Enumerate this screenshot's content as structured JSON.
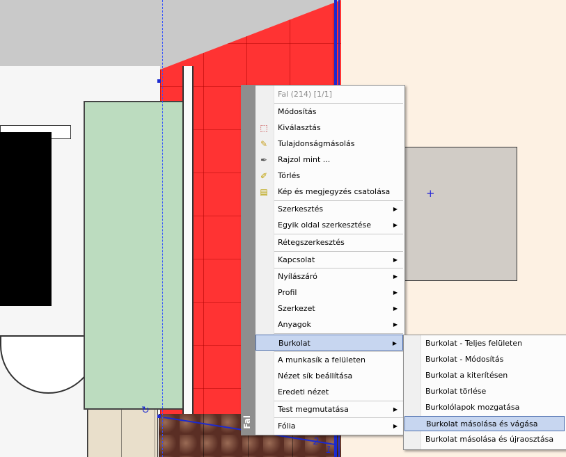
{
  "menu": {
    "side_label": "Fal",
    "header": "Fal (214) [1/1]",
    "items": [
      {
        "label": "Módosítás"
      },
      {
        "label": "Kiválasztás",
        "icon": "selection-icon"
      },
      {
        "label": "Tulajdonságmásolás",
        "icon": "brush-icon"
      },
      {
        "label": "Rajzol mint ...",
        "icon": "pipette-icon"
      },
      {
        "label": "Törlés",
        "icon": "eraser-icon"
      },
      {
        "label": "Kép és megjegyzés csatolása",
        "icon": "note-icon"
      },
      {
        "label": "Szerkesztés"
      },
      {
        "label": "Egyik oldal szerkesztése"
      },
      {
        "label": "Rétegszerkesztés"
      },
      {
        "label": "Kapcsolat"
      },
      {
        "label": "Nyílászáró"
      },
      {
        "label": "Profil"
      },
      {
        "label": "Szerkezet"
      },
      {
        "label": "Anyagok"
      },
      {
        "label": "Burkolat"
      },
      {
        "label": "A munkasík a felületen"
      },
      {
        "label": "Nézet sík beállítása"
      },
      {
        "label": "Eredeti nézet"
      },
      {
        "label": "Test megmutatása"
      },
      {
        "label": "Fólia"
      }
    ]
  },
  "submenu": {
    "items": [
      {
        "label": "Burkolat - Teljes felületen"
      },
      {
        "label": "Burkolat - Módosítás"
      },
      {
        "label": "Burkolat a kiterítésen"
      },
      {
        "label": "Burkolat törlése"
      },
      {
        "label": "Burkolólapok mozgatása"
      },
      {
        "label": "Burkolat másolása és vágása"
      },
      {
        "label": "Burkolat másolása és újraosztása"
      }
    ]
  },
  "viewport": {
    "dim_label_1": "2",
    "dim_label_2": "1"
  },
  "colors": {
    "wall_highlight": "#ff3333",
    "selection_blue": "#1b2ad0",
    "menu_highlight": "#c7d6f0"
  }
}
